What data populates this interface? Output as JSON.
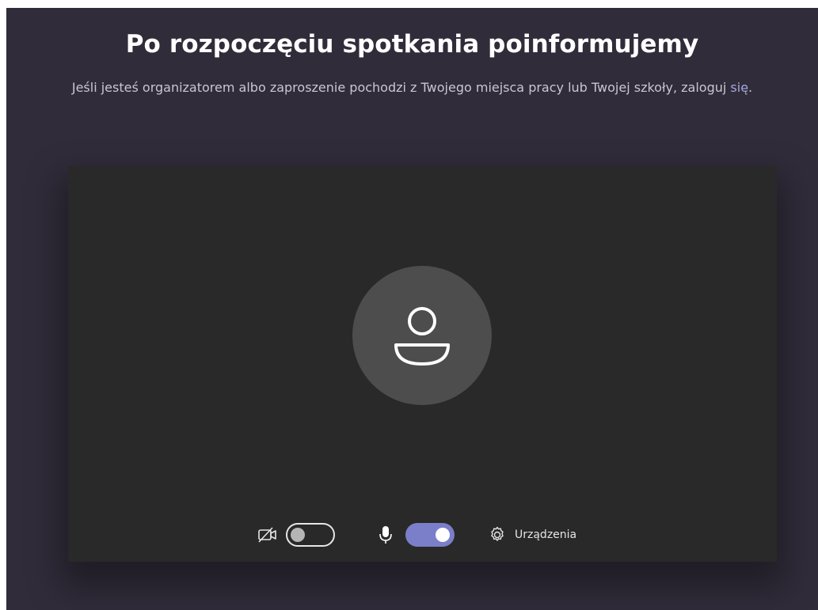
{
  "header": {
    "title": "Po rozpoczęciu spotkania poinformujemy",
    "subtitle_before_link": "Jeśli jesteś organizatorem albo zaproszenie pochodzi z Twojego miejsca pracy lub Twojej szkoły, zaloguj ",
    "sign_in_link": "się",
    "subtitle_after_link": "."
  },
  "preview": {
    "avatar_icon": "person-icon"
  },
  "controls": {
    "camera": {
      "icon": "camera-off-icon",
      "enabled": false
    },
    "microphone": {
      "icon": "microphone-icon",
      "enabled": true
    },
    "devices": {
      "icon": "gear-icon",
      "label": "Urządzenia"
    }
  },
  "colors": {
    "background": "#302c3a",
    "preview": "#292929",
    "avatar": "#4d4d4d",
    "accent": "#7b7fc9",
    "link": "#a6a7dc"
  }
}
